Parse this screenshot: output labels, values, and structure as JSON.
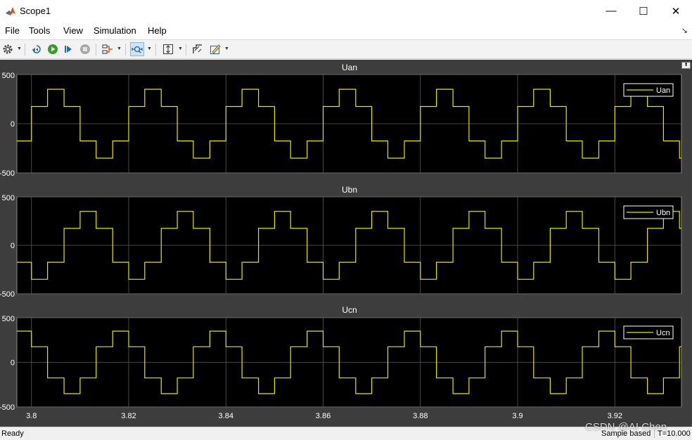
{
  "window": {
    "title": "Scope1",
    "buttons": {
      "minimize": "—",
      "maximize": "☐",
      "close": "✕"
    }
  },
  "menu": {
    "items": [
      "File",
      "Tools",
      "View",
      "Simulation",
      "Help"
    ]
  },
  "toolbar": {
    "icons": [
      "settings-gear-icon",
      "step-back-icon",
      "run-icon",
      "step-forward-icon",
      "stop-icon",
      "signal-selector-icon",
      "zoom-icon",
      "scale-axes-icon",
      "cursor-measure-icon",
      "style-icon"
    ]
  },
  "colors": {
    "plot_bg": "#000000",
    "figure_bg": "#3d3d3d",
    "signal": "#e6e600",
    "grid": "#5a5a5a",
    "axis_text": "#ffffff"
  },
  "chart_data": [
    {
      "type": "line",
      "title": "Uan",
      "series": [
        {
          "name": "Uan",
          "x": [
            3.797,
            3.8,
            3.8033,
            3.8067,
            3.81,
            3.8133,
            3.8167,
            3.82,
            3.8233,
            3.8267,
            3.83,
            3.8333,
            3.8367,
            3.84,
            3.8433,
            3.8467,
            3.85,
            3.8533,
            3.8567,
            3.86,
            3.8633,
            3.8667,
            3.87,
            3.8733,
            3.8767,
            3.88,
            3.8833,
            3.8867,
            3.89,
            3.8933,
            3.8967,
            3.9,
            3.9033,
            3.9067,
            3.91,
            3.9133,
            3.9167,
            3.92,
            3.9233,
            3.9267,
            3.93,
            3.9333,
            3.9337
          ],
          "y": [
            -175,
            175,
            350,
            175,
            -175,
            -350,
            -175,
            175,
            350,
            175,
            -175,
            -350,
            -175,
            175,
            350,
            175,
            -175,
            -350,
            -175,
            175,
            350,
            175,
            -175,
            -350,
            -175,
            175,
            350,
            175,
            -175,
            -350,
            -175,
            175,
            350,
            175,
            -175,
            -350,
            -175,
            175,
            350,
            175,
            -175,
            -350,
            -350
          ]
        }
      ],
      "xlim": [
        3.797,
        3.9337
      ],
      "ylim": [
        -500,
        500
      ],
      "yticks": [
        -500,
        0,
        500
      ],
      "grid": true,
      "legend": "top-right"
    },
    {
      "type": "line",
      "title": "Ubn",
      "series": [
        {
          "name": "Ubn",
          "x": [
            3.797,
            3.8,
            3.8033,
            3.8067,
            3.81,
            3.8133,
            3.8167,
            3.82,
            3.8233,
            3.8267,
            3.83,
            3.8333,
            3.8367,
            3.84,
            3.8433,
            3.8467,
            3.85,
            3.8533,
            3.8567,
            3.86,
            3.8633,
            3.8667,
            3.87,
            3.8733,
            3.8767,
            3.88,
            3.8833,
            3.8867,
            3.89,
            3.8933,
            3.8967,
            3.9,
            3.9033,
            3.9067,
            3.91,
            3.9133,
            3.9167,
            3.92,
            3.9233,
            3.9267,
            3.93,
            3.9333,
            3.9337
          ],
          "y": [
            -175,
            -350,
            -175,
            175,
            350,
            175,
            -175,
            -350,
            -175,
            175,
            350,
            175,
            -175,
            -350,
            -175,
            175,
            350,
            175,
            -175,
            -350,
            -175,
            175,
            350,
            175,
            -175,
            -350,
            -175,
            175,
            350,
            175,
            -175,
            -350,
            -175,
            175,
            350,
            175,
            -175,
            -350,
            -175,
            175,
            350,
            175,
            175
          ]
        }
      ],
      "xlim": [
        3.797,
        3.9337
      ],
      "ylim": [
        -500,
        500
      ],
      "yticks": [
        -500,
        0,
        500
      ],
      "grid": true,
      "legend": "top-right"
    },
    {
      "type": "line",
      "title": "Ucn",
      "series": [
        {
          "name": "Ucn",
          "x": [
            3.797,
            3.8,
            3.8033,
            3.8067,
            3.81,
            3.8133,
            3.8167,
            3.82,
            3.8233,
            3.8267,
            3.83,
            3.8333,
            3.8367,
            3.84,
            3.8433,
            3.8467,
            3.85,
            3.8533,
            3.8567,
            3.86,
            3.8633,
            3.8667,
            3.87,
            3.8733,
            3.8767,
            3.88,
            3.8833,
            3.8867,
            3.89,
            3.8933,
            3.8967,
            3.9,
            3.9033,
            3.9067,
            3.91,
            3.9133,
            3.9167,
            3.92,
            3.9233,
            3.9267,
            3.93,
            3.9333,
            3.9337
          ],
          "y": [
            350,
            175,
            -175,
            -350,
            -175,
            175,
            350,
            175,
            -175,
            -350,
            -175,
            175,
            350,
            175,
            -175,
            -350,
            -175,
            175,
            350,
            175,
            -175,
            -350,
            -175,
            175,
            350,
            175,
            -175,
            -350,
            -175,
            175,
            350,
            175,
            -175,
            -350,
            -175,
            175,
            350,
            175,
            -175,
            -350,
            -175,
            175,
            175
          ]
        }
      ],
      "xlim": [
        3.797,
        3.9337
      ],
      "ylim": [
        -500,
        500
      ],
      "yticks": [
        -500,
        0,
        500
      ],
      "xticks": [
        3.8,
        3.82,
        3.84,
        3.86,
        3.88,
        3.9,
        3.92
      ],
      "xticklabels": [
        "3.8",
        "3.82",
        "3.84",
        "3.86",
        "3.88",
        "3.9",
        "3.92"
      ],
      "grid": true,
      "legend": "top-right"
    }
  ],
  "status": {
    "text": "Ready",
    "mode": "Sample based",
    "time": "T=10.000"
  },
  "watermark": "CSDN @AI Chen"
}
